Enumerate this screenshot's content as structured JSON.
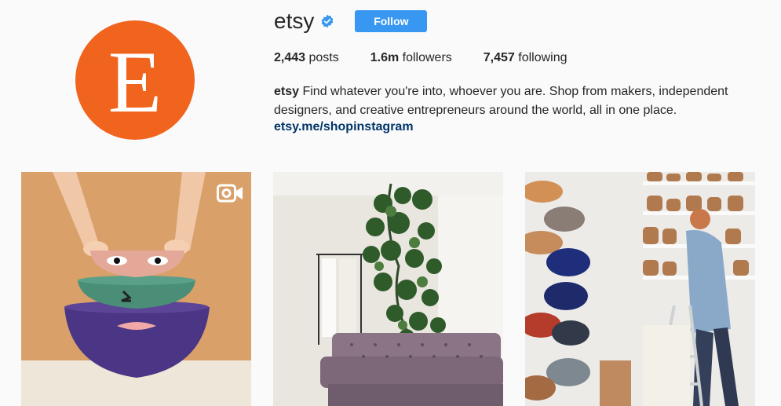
{
  "profile": {
    "avatar_letter": "E",
    "username": "etsy",
    "follow_label": "Follow",
    "stats": {
      "posts_count": "2,443",
      "posts_label": " posts",
      "followers_count": "1.6m",
      "followers_label": " followers",
      "following_count": "7,457",
      "following_label": " following"
    },
    "bio_name": "etsy",
    "bio_text": " Find whatever you're into, whoever you are. Shop from makers, independent designers, and creative entrepreneurs around the world, all in one place.",
    "link": "etsy.me/shopinstagram"
  },
  "colors": {
    "brand_orange": "#f1641e",
    "follow_blue": "#3897f0",
    "link_blue": "#003569",
    "verified_blue": "#3897f0"
  },
  "posts": [
    {
      "subject": "stacked bowls with painted faces",
      "has_video": true,
      "video_icon": "video-camera-icon"
    },
    {
      "subject": "living room with velvet sofa and hanging plant",
      "has_video": false
    },
    {
      "subject": "hat maker arranging hat forms on shelves",
      "has_video": false
    }
  ]
}
